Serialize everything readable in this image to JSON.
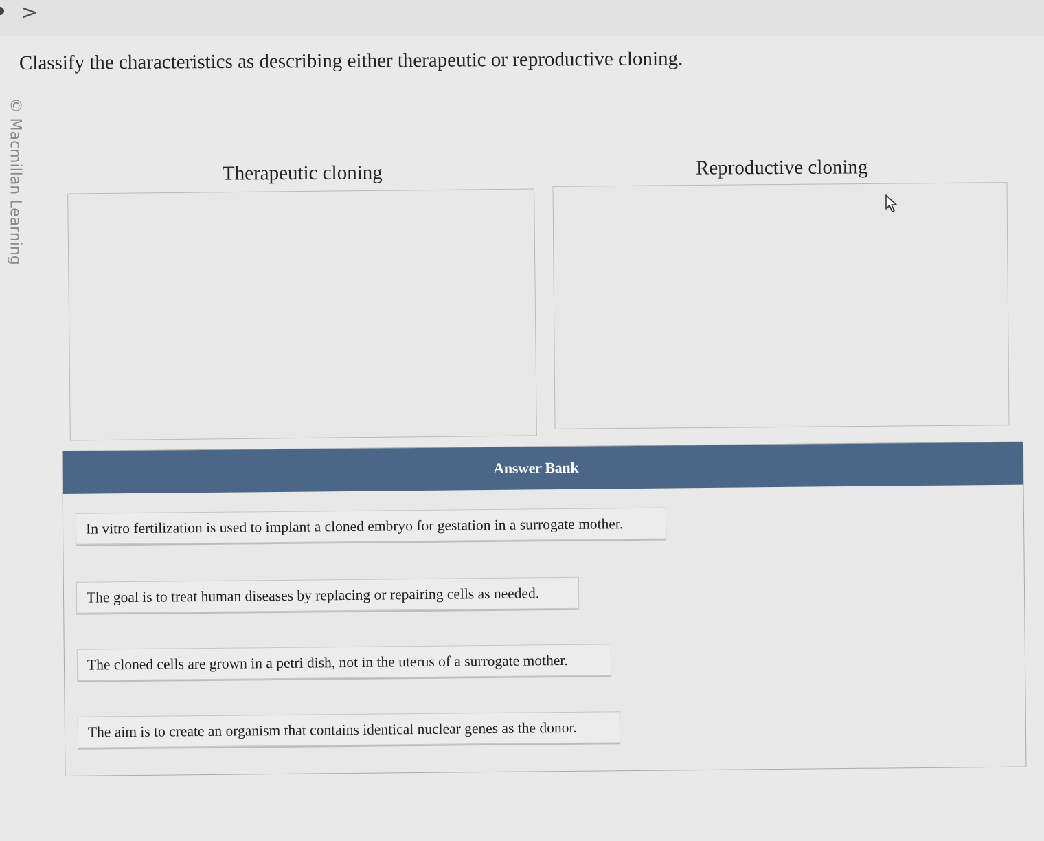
{
  "brand": {
    "side_text": "© Macmillan Learning"
  },
  "navigation": {
    "next_glyph": ">"
  },
  "question": {
    "prompt": "Classify the characteristics as describing either therapeutic or reproductive cloning."
  },
  "categories": [
    {
      "label": "Therapeutic cloning"
    },
    {
      "label": "Reproductive cloning"
    }
  ],
  "answer_bank": {
    "title": "Answer Bank",
    "header_color": "#4b6787",
    "items": [
      {
        "text": "In vitro fertilization is used to implant a cloned embryo for gestation in a surrogate mother."
      },
      {
        "text": "The goal is to treat human diseases by replacing or repairing cells as needed."
      },
      {
        "text": "The cloned cells are grown in a petri dish, not in the uterus of a surrogate mother."
      },
      {
        "text": "The aim is to create an organism that contains identical nuclear genes as the donor."
      }
    ]
  }
}
